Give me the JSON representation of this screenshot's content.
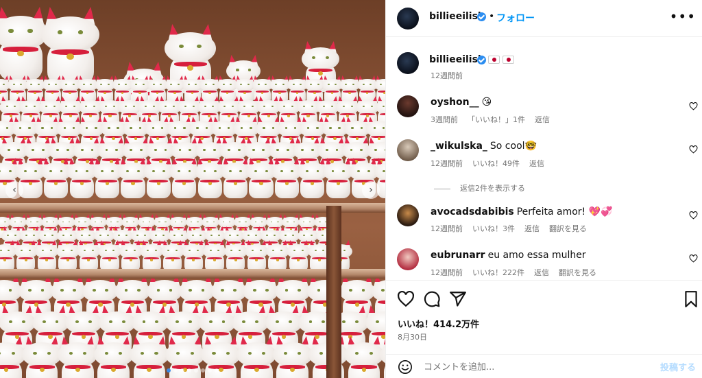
{
  "post": {
    "author": "billieeilish",
    "verified": true,
    "follow_label": "フォロー",
    "separator": "•",
    "more_label": "•••",
    "image_alt": "maneki-neko cat figurines on shelves"
  },
  "caption": {
    "username": "billieeilish",
    "flags": [
      "japan-flag",
      "japan-flag"
    ],
    "time": "12週間前"
  },
  "comments": [
    {
      "username": "oyshon__",
      "text": "😘",
      "time": "3週間前",
      "likes": "「いいね！」1件",
      "reply": "返信",
      "translate": ""
    },
    {
      "username": "_wikulska_",
      "text": "So cool🤓",
      "time": "12週間前",
      "likes": "いいね！49件",
      "reply": "返信",
      "translate": ""
    },
    {
      "username": "avocadsdabibis",
      "text": "Perfeita amor! 💖💞",
      "time": "12週間前",
      "likes": "いいね！3件",
      "reply": "返信",
      "translate": "翻訳を見る"
    },
    {
      "username": "eubrunarr",
      "text": "eu amo essa mulher",
      "time": "12週間前",
      "likes": "いいね！222件",
      "reply": "返信",
      "translate": "翻訳を見る"
    }
  ],
  "view_replies": "返信2件を表示する",
  "actions": {
    "likes_total": "いいね！414.2万件",
    "date": "8月30日"
  },
  "compose": {
    "placeholder": "コメントを追加...",
    "post_label": "投稿する"
  },
  "carousel": {
    "slides": 8,
    "current": 1
  },
  "colors": {
    "accent": "#0095f6",
    "verified": "#2b8df0",
    "muted": "#737373"
  }
}
